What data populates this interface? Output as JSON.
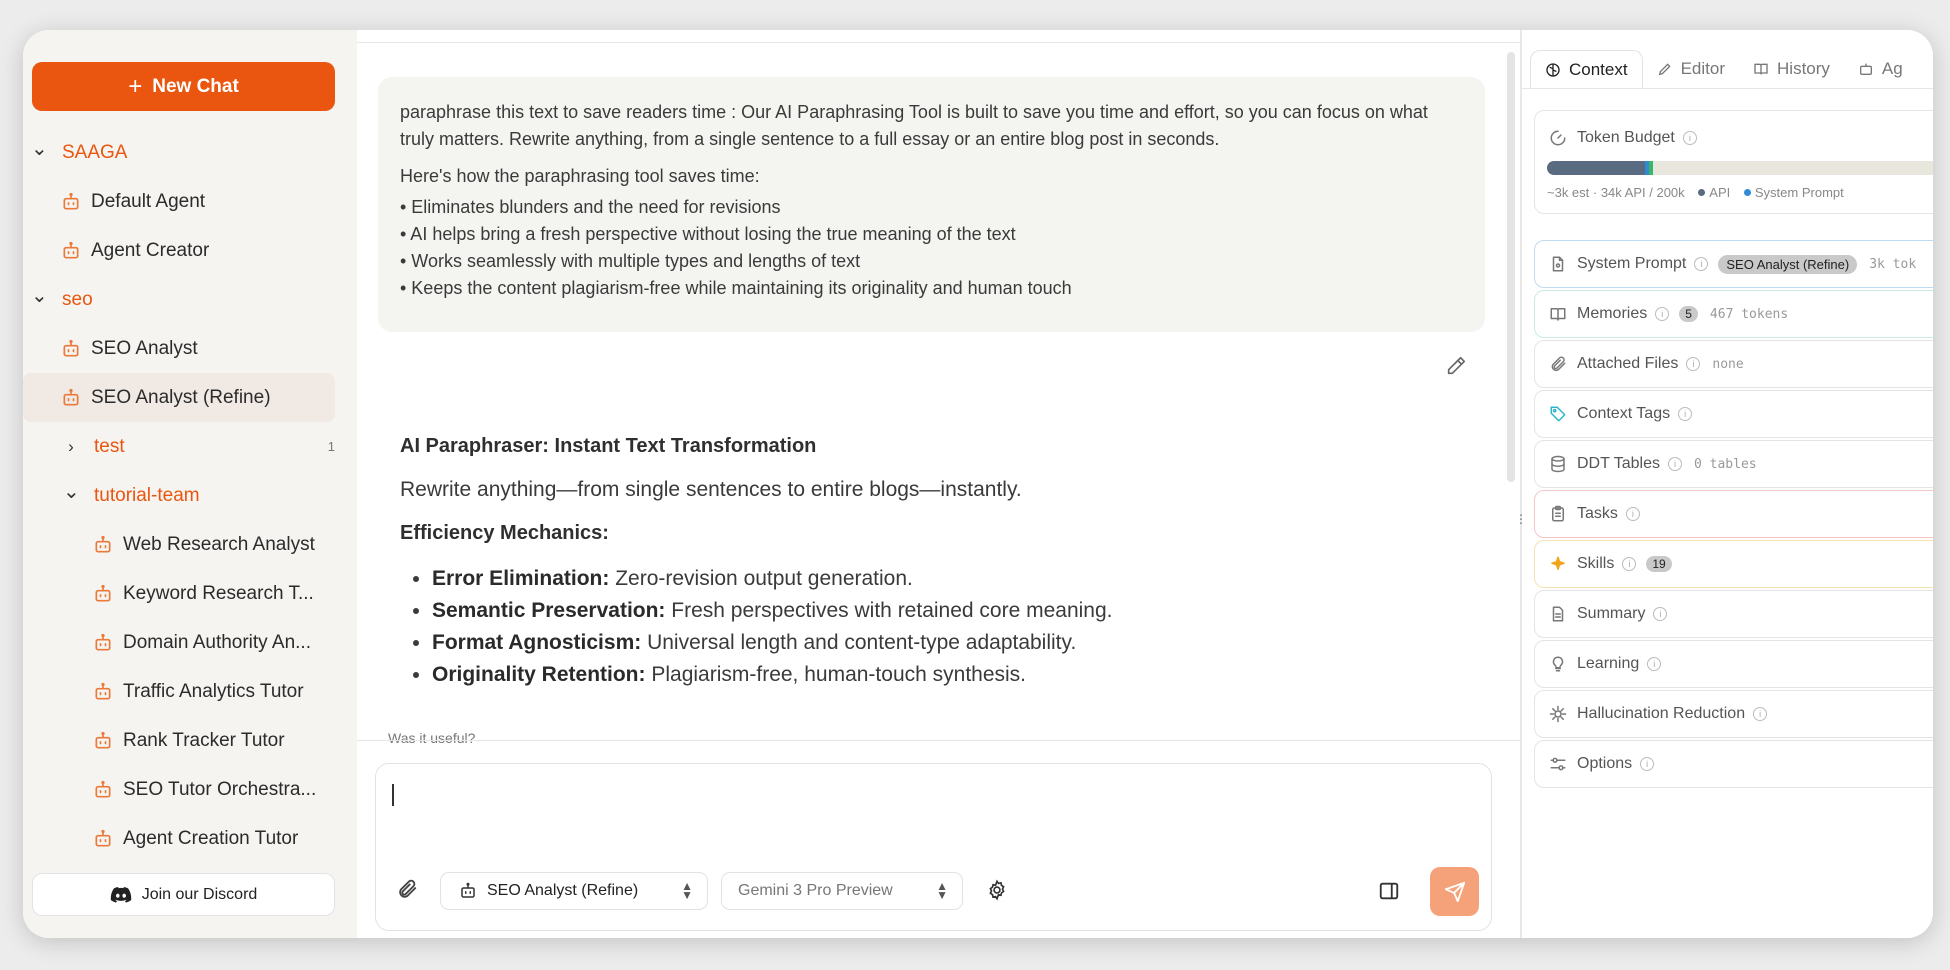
{
  "sidebar": {
    "new_chat": "New Chat",
    "tree": [
      {
        "type": "folder",
        "label": "SAAGA",
        "expanded": true,
        "depth": 0
      },
      {
        "type": "agent",
        "label": "Default Agent",
        "depth": 1
      },
      {
        "type": "agent",
        "label": "Agent Creator",
        "depth": 1
      },
      {
        "type": "folder",
        "label": "seo",
        "expanded": true,
        "depth": 0
      },
      {
        "type": "agent",
        "label": "SEO Analyst",
        "depth": 1
      },
      {
        "type": "agent",
        "label": "SEO Analyst (Refine)",
        "depth": 1,
        "active": true
      },
      {
        "type": "folder",
        "label": "test",
        "expanded": false,
        "depth": 1,
        "count": "1"
      },
      {
        "type": "folder",
        "label": "tutorial-team",
        "expanded": true,
        "depth": 1
      },
      {
        "type": "agent",
        "label": "Web Research Analyst",
        "depth": 2
      },
      {
        "type": "agent",
        "label": "Keyword Research T...",
        "depth": 2
      },
      {
        "type": "agent",
        "label": "Domain Authority An...",
        "depth": 2
      },
      {
        "type": "agent",
        "label": "Traffic Analytics Tutor",
        "depth": 2
      },
      {
        "type": "agent",
        "label": "Rank Tracker Tutor",
        "depth": 2
      },
      {
        "type": "agent",
        "label": "SEO Tutor Orchestra...",
        "depth": 2
      },
      {
        "type": "agent",
        "label": "Agent Creation Tutor",
        "depth": 2
      }
    ],
    "discord": "Join our Discord"
  },
  "chat": {
    "user_message": {
      "intro": "paraphrase this text to save readers time : Our AI Paraphrasing Tool is built to save you time and effort, so you can focus on what truly matters. Rewrite anything, from a single sentence to a full essay or an entire blog post in seconds.",
      "lead": "Here's how the paraphrasing tool saves time:",
      "bullets": [
        "• Eliminates blunders and the need for revisions",
        "• AI helps bring a fresh perspective without losing the true meaning of the text",
        "• Works seamlessly with multiple types and lengths of text",
        "• Keeps the content plagiarism-free while maintaining its originality and human touch"
      ]
    },
    "ai_response": {
      "title": "AI Paraphraser: Instant Text Transformation",
      "subtitle": "Rewrite anything—from single sentences to entire blogs—instantly.",
      "section": "Efficiency Mechanics:",
      "items": [
        {
          "bold": "Error Elimination:",
          "text": " Zero-revision output generation."
        },
        {
          "bold": "Semantic Preservation:",
          "text": " Fresh perspectives with retained core meaning."
        },
        {
          "bold": "Format Agnosticism:",
          "text": " Universal length and content-type adaptability."
        },
        {
          "bold": "Originality Retention:",
          "text": " Plagiarism-free, human-touch synthesis."
        }
      ]
    },
    "feedback_prompt": "Was it useful?"
  },
  "composer": {
    "agent_select": "SEO Analyst (Refine)",
    "model_select": "Gemini 3 Pro Preview"
  },
  "right_panel": {
    "tabs": [
      {
        "label": "Context",
        "active": true,
        "icon": "brain-icon"
      },
      {
        "label": "Editor",
        "icon": "pen-icon"
      },
      {
        "label": "History",
        "icon": "book-icon"
      },
      {
        "label": "Ag",
        "icon": "robot-icon"
      }
    ],
    "token_budget": {
      "title": "Token Budget",
      "api_fraction": 0.245,
      "system_fraction": 0.02,
      "legend_text": "~3k est · 34k API / 200k",
      "legend_api": "API",
      "legend_system": "System Prompt",
      "api_color": "#5a6a80",
      "system_color": "#2f8bd6"
    },
    "cards": [
      {
        "label": "System Prompt",
        "icon": "document-icon",
        "pill": "SEO Analyst (Refine)",
        "tag": "3k tok",
        "border": "#bfdcf5"
      },
      {
        "label": "Memories",
        "icon": "book-icon",
        "num": "5",
        "tag": "467 tokens",
        "border": "#c9ece0"
      },
      {
        "label": "Attached Files",
        "icon": "paperclip-icon",
        "tag": "none",
        "border": "#e4e4e4"
      },
      {
        "label": "Context Tags",
        "icon": "tag-icon",
        "border": "#e4e4e4"
      },
      {
        "label": "DDT Tables",
        "icon": "database-icon",
        "tag": "0 tables",
        "border": "#e4e4e4"
      },
      {
        "label": "Tasks",
        "icon": "clipboard-icon",
        "border": "#f5c6c6"
      },
      {
        "label": "Skills",
        "icon": "sparkle-icon",
        "num": "19",
        "border": "#f6e2b3"
      },
      {
        "label": "Summary",
        "icon": "file-text-icon",
        "border": "#e4e4e4"
      },
      {
        "label": "Learning",
        "icon": "lightbulb-icon",
        "border": "#e4e4e4"
      },
      {
        "label": "Hallucination Reduction",
        "icon": "bug-icon",
        "border": "#e4e4e4"
      },
      {
        "label": "Options",
        "icon": "sliders-icon",
        "border": "#e4e4e4"
      }
    ]
  },
  "colors": {
    "accent": "#ea560f",
    "send_disabled": "#f5a27a"
  }
}
